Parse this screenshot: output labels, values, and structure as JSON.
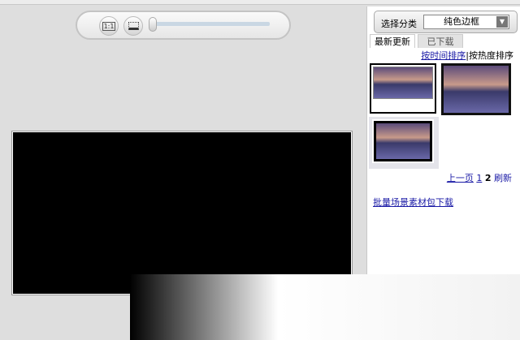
{
  "toolbar": {
    "actual_size_label": "1:1",
    "zoom_level": 0
  },
  "panel": {
    "category_label": "选择分类",
    "category_value": "纯色边框",
    "tabs": [
      {
        "label": "最新更新",
        "active": true
      },
      {
        "label": "已下载",
        "active": false
      }
    ],
    "sort_by_time": "按时间排序",
    "sort_separator": "|",
    "sort_by_popularity": "按热度排序",
    "pager": {
      "prev": "上一页",
      "page1": "1",
      "current": "2",
      "refresh": "刷新"
    },
    "bulk_download": "批量场景素材包下载"
  }
}
